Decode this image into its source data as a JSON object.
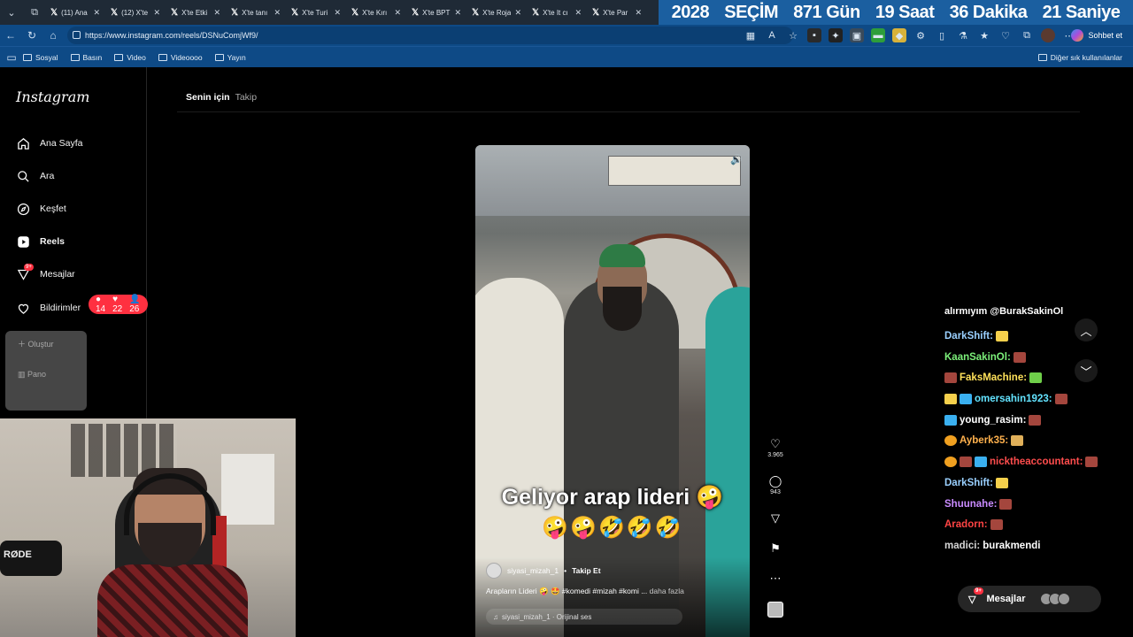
{
  "browser": {
    "tabs": [
      {
        "label": "(11) Ana"
      },
      {
        "label": "(12) X'te"
      },
      {
        "label": "X'te Etki"
      },
      {
        "label": "X'te tanı"
      },
      {
        "label": "X'te Turi"
      },
      {
        "label": "X'te Kırı"
      },
      {
        "label": "X'te BPT"
      },
      {
        "label": "X'te Roja"
      },
      {
        "label": "X'te It cı"
      },
      {
        "label": "X'te Par"
      }
    ],
    "banner": [
      "2028",
      "SEÇİM",
      "871 Gün",
      "19 Saat",
      "36 Dakika",
      "21 Saniye"
    ],
    "url": "https://www.instagram.com/reels/DSNuComjWf9/",
    "chat_button": "Sohbet et",
    "bookmarks": [
      "Sosyal",
      "Basın",
      "Video",
      "Videoooo",
      "Yayın"
    ],
    "bookmarks_right": "Diğer sık kullanılanlar"
  },
  "instagram": {
    "logo": "Instagram",
    "nav": [
      {
        "label": "Ana Sayfa",
        "icon": "home-icon"
      },
      {
        "label": "Ara",
        "icon": "search-icon"
      },
      {
        "label": "Keşfet",
        "icon": "compass-icon"
      },
      {
        "label": "Reels",
        "icon": "reels-icon"
      },
      {
        "label": "Mesajlar",
        "icon": "messenger-icon",
        "badge": "9+"
      },
      {
        "label": "Bildirimler",
        "icon": "heart-icon"
      }
    ],
    "notifications": {
      "comments": "14",
      "likes": "22",
      "follows": "26"
    },
    "overlay_items": [
      "Oluştur",
      "Pano"
    ],
    "feed_tabs": [
      "Senin için",
      "Takip"
    ],
    "reel": {
      "caption": "Geliyor arap lideri",
      "username": "siyasi_mizah_1",
      "follow": "Takip Et",
      "description": "Arapların Lideri",
      "hashtags": "#komedi #mizah #komi ...",
      "more": "daha fazla",
      "audio": "siyasi_mizah_1 · Orijinal ses",
      "likes": "3.965",
      "comments": "943"
    },
    "messages_dock": {
      "label": "Mesajlar",
      "badge": "9+"
    }
  },
  "chat": {
    "cut_line": "alırmıyım @BurakSakinOl",
    "messages": [
      {
        "user": "DarkShift:",
        "color": "#9ad0ff",
        "text": ""
      },
      {
        "user": "KaanSakinOl:",
        "color": "#7cf07a",
        "text": ""
      },
      {
        "user": "FaksMachine:",
        "color": "#ffe15a",
        "text": ""
      },
      {
        "user": "omersahin1923:",
        "color": "#63e3ff",
        "text": ""
      },
      {
        "user": "young_rasim:",
        "color": "#ffffff",
        "text": ""
      },
      {
        "user": "Ayberk35:",
        "color": "#ffb14d",
        "text": ""
      },
      {
        "user": "nicktheaccountant:",
        "color": "#ff4d4d",
        "text": ""
      },
      {
        "user": "DarkShift:",
        "color": "#9ad0ff",
        "text": ""
      },
      {
        "user": "Shuunahe:",
        "color": "#c98bff",
        "text": ""
      },
      {
        "user": "Aradorn:",
        "color": "#ff4444",
        "text": ""
      },
      {
        "user": "madici:",
        "color": "#d6d6d6",
        "text": "burakmendi"
      }
    ]
  },
  "webcam": {
    "mic_brand": "RØDE"
  },
  "colors": {
    "accent_red": "#ff3040",
    "browser_blue": "#0e4a86",
    "banner_blue": "#1b5fa0"
  }
}
